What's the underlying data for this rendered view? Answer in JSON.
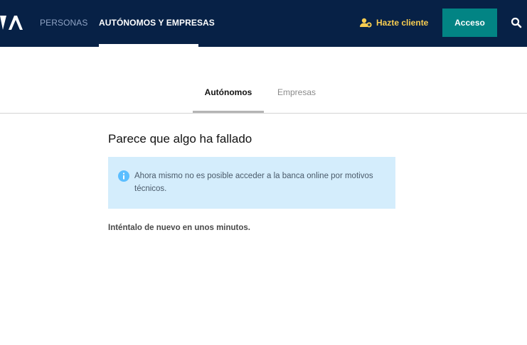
{
  "header": {
    "brand_icon": "bbva-logo-partial",
    "nav": [
      {
        "label": "PERSONAS",
        "active": false
      },
      {
        "label": "AUTÓNOMOS Y EMPRESAS",
        "active": true
      }
    ],
    "hazte_cliente": {
      "label": "Hazte cliente",
      "icon": "user-add-icon"
    },
    "acceso_label": "Acceso",
    "search_icon": "search-icon",
    "colors": {
      "background": "#072146",
      "accent": "#f8cd51",
      "button": "#028484"
    }
  },
  "tabs": [
    {
      "label": "Autónomos",
      "active": true
    },
    {
      "label": "Empresas",
      "active": false
    }
  ],
  "content": {
    "title": "Parece que algo ha fallado",
    "info": {
      "icon": "info-icon",
      "text": "Ahora mismo no es posible acceder a la banca online por motivos técnicos.",
      "background": "#d4edfc"
    },
    "retry_text": "Inténtalo de nuevo en unos minutos."
  }
}
